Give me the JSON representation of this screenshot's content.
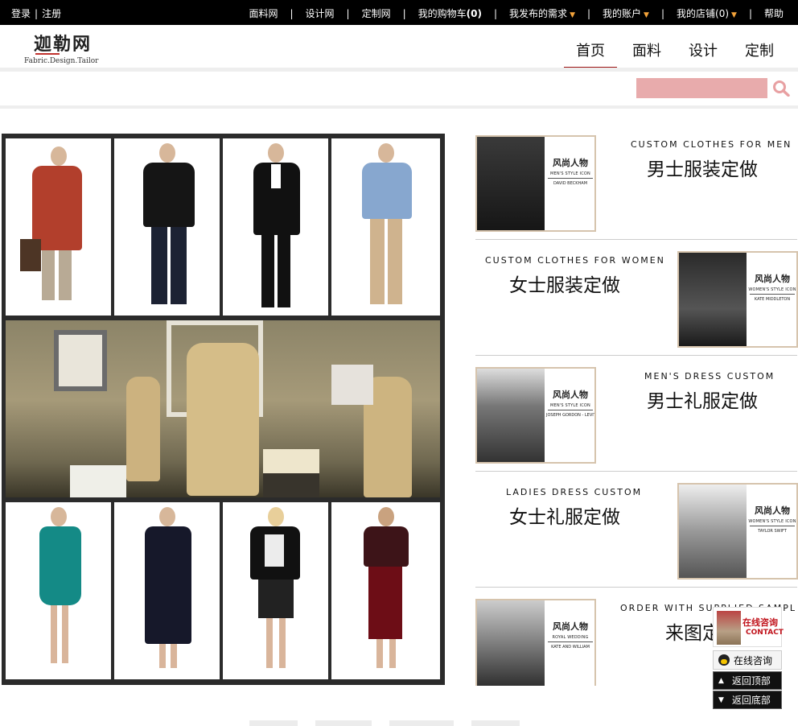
{
  "topbar": {
    "login": "登录",
    "register": "注册",
    "links": [
      {
        "label": "面料网"
      },
      {
        "label": "设计网"
      },
      {
        "label": "定制网"
      },
      {
        "label": "我的购物车",
        "count": "(0)"
      },
      {
        "label": "我发布的需求",
        "caret": "»"
      },
      {
        "label": "我的账户",
        "caret": "»"
      },
      {
        "label": "我的店铺(0)",
        "caret": "»"
      },
      {
        "label": "帮助"
      }
    ]
  },
  "logo": {
    "cn": "迦勒网",
    "en": "Fabric.Design.Tailor"
  },
  "nav": {
    "tabs": [
      "首页",
      "面料",
      "设计",
      "定制"
    ],
    "active": 0
  },
  "search": {
    "placeholder": "",
    "icon": "search-icon"
  },
  "features": [
    {
      "en": "CUSTOM CLOTHES FOR MEN",
      "cn": "男士服装定做",
      "card": {
        "title": "风尚人物",
        "subtitle": "MEN'S STYLE ICON",
        "name": "DAVID BECKHAM"
      }
    },
    {
      "en": "CUSTOM CLOTHES FOR WOMEN",
      "cn": "女士服装定做",
      "card": {
        "title": "风尚人物",
        "subtitle": "WOMEN'S STYLE ICON",
        "name": "KATE MIDDLETON"
      }
    },
    {
      "en": "MEN'S DRESS CUSTOM",
      "cn": "男士礼服定做",
      "card": {
        "title": "风尚人物",
        "subtitle": "MEN'S STYLE ICON",
        "name": "JOSEPH GORDON - LEVITT"
      }
    },
    {
      "en": "LADIES DRESS CUSTOM",
      "cn": "女士礼服定做",
      "card": {
        "title": "风尚人物",
        "subtitle": "WOMEN'S STYLE ICON",
        "name": "TAYLOR SWIFT"
      }
    },
    {
      "en": "ORDER WITH SUPPLIED SAMPLE",
      "cn": "来图定",
      "card": {
        "title": "风尚人物",
        "subtitle": "ROYAL WEDDING",
        "name": "KATE AND WILLIAM"
      }
    }
  ],
  "side_widget": {
    "contact_cn": "在线咨询",
    "contact_en": "CONTACT",
    "online": "在线咨询",
    "to_top": "返回顶部",
    "to_bottom": "返回底部"
  }
}
